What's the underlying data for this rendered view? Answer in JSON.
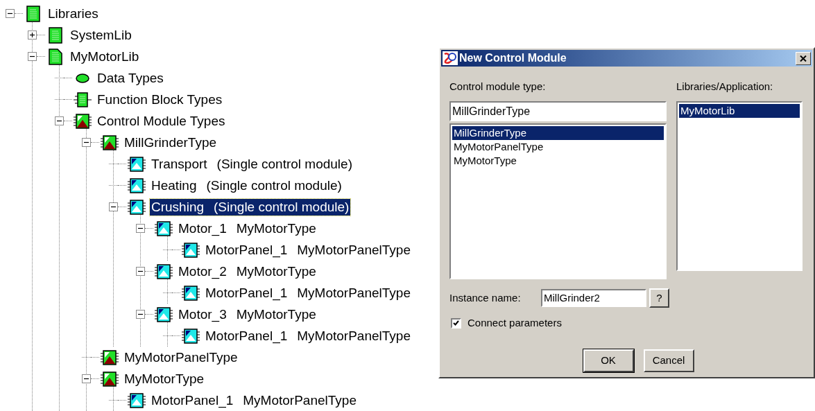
{
  "tree": [
    {
      "label": "Libraries",
      "kind": "library",
      "expanded": true,
      "selected": false,
      "children": [
        {
          "label": "SystemLib",
          "kind": "library",
          "expanded": false,
          "selected": false
        },
        {
          "label": "MyMotorLib",
          "kind": "library-open",
          "expanded": true,
          "selected": false,
          "children": [
            {
              "label": "Data Types",
              "kind": "datatype",
              "selected": false
            },
            {
              "label": "Function Block Types",
              "kind": "block",
              "selected": false
            },
            {
              "label": "Control Module Types",
              "kind": "cm-type",
              "expanded": true,
              "selected": false,
              "children": [
                {
                  "label": "MillGrinderType",
                  "kind": "cm-type",
                  "expanded": true,
                  "selected": false,
                  "children": [
                    {
                      "label": "Transport",
                      "detail": "(Single control module)",
                      "kind": "cm",
                      "selected": false
                    },
                    {
                      "label": "Heating",
                      "detail": "(Single control module)",
                      "kind": "cm",
                      "selected": false
                    },
                    {
                      "label": "Crushing",
                      "detail": "(Single control module)",
                      "kind": "cm",
                      "expanded": true,
                      "selected": true,
                      "children": [
                        {
                          "label": "Motor_1",
                          "detail": "MyMotorType",
                          "kind": "cm",
                          "expanded": true,
                          "selected": false,
                          "children": [
                            {
                              "label": "MotorPanel_1",
                              "detail": "MyMotorPanelType",
                              "kind": "cm",
                              "selected": false
                            }
                          ]
                        },
                        {
                          "label": "Motor_2",
                          "detail": "MyMotorType",
                          "kind": "cm",
                          "expanded": true,
                          "selected": false,
                          "children": [
                            {
                              "label": "MotorPanel_1",
                              "detail": "MyMotorPanelType",
                              "kind": "cm",
                              "selected": false
                            }
                          ]
                        },
                        {
                          "label": "Motor_3",
                          "detail": "MyMotorType",
                          "kind": "cm",
                          "expanded": true,
                          "selected": false,
                          "children": [
                            {
                              "label": "MotorPanel_1",
                              "detail": "MyMotorPanelType",
                              "kind": "cm",
                              "selected": false
                            }
                          ]
                        }
                      ]
                    }
                  ]
                },
                {
                  "label": "MyMotorPanelType",
                  "kind": "cm-type",
                  "selected": false
                },
                {
                  "label": "MyMotorType",
                  "kind": "cm-type",
                  "expanded": true,
                  "selected": false,
                  "children": [
                    {
                      "label": "MotorPanel_1",
                      "detail": "MyMotorPanelType",
                      "kind": "cm",
                      "selected": false
                    }
                  ]
                }
              ]
            }
          ]
        }
      ]
    }
  ],
  "dialog": {
    "title": "New Control Module",
    "type_label": "Control module type:",
    "type_value": "MillGrinderType",
    "types": [
      {
        "label": "MillGrinderType",
        "selected": true
      },
      {
        "label": "MyMotorPanelType",
        "selected": false
      },
      {
        "label": "MyMotorType",
        "selected": false
      }
    ],
    "libraries_label": "Libraries/Application:",
    "libraries": [
      {
        "label": "MyMotorLib",
        "selected": true
      }
    ],
    "instance_label": "Instance name:",
    "instance_value": "MillGrinder2",
    "help_button": "?",
    "connect": {
      "label": "Connect parameters",
      "checked": true
    },
    "buttons": [
      "OK",
      "Cancel"
    ]
  }
}
